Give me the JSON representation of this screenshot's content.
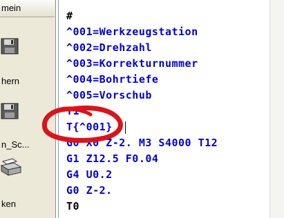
{
  "sidebar": {
    "tab_label": "mein",
    "items": [
      {
        "label": "",
        "icon": "save-icon"
      },
      {
        "label": "hern",
        "icon": "save-as-icon"
      },
      {
        "label": "n_Sc...",
        "icon": "screenshot-icon"
      },
      {
        "label": "ken",
        "icon": "print-icon"
      }
    ]
  },
  "editor": {
    "lines": [
      "#",
      "^001=Werkzeugstation",
      "^002=Drehzahl",
      "^003=Korrekturnummer",
      "^004=Bohrtiefe",
      "^005=Vorschub",
      "T1",
      "T{^001}",
      "G0 X0 Z-2. M3 S4000 T12",
      "G1 Z12.5 F0.04",
      "G4 U0.2",
      "G0 Z-2.",
      "T0"
    ]
  },
  "colors": {
    "code_text": "#0000cc",
    "highlight_circle": "#d8141c"
  }
}
